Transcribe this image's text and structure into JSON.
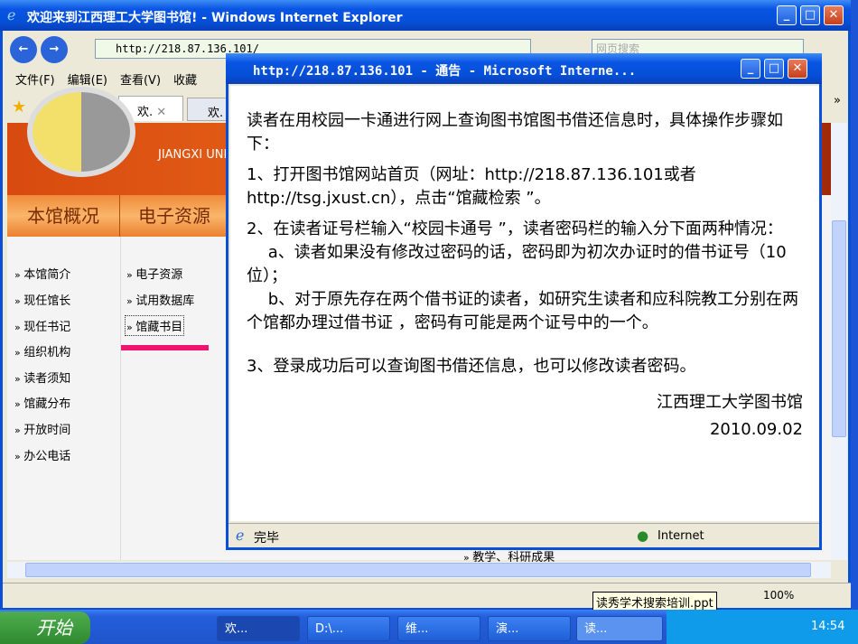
{
  "browser": {
    "title": "欢迎来到江西理工大学图书馆! - Windows Internet Explorer",
    "address": "http://218.87.136.101/",
    "search_placeholder": "网页搜索",
    "menu": [
      "文件(F)",
      "编辑(E)",
      "查看(V)",
      "收藏"
    ],
    "tabs": [
      "欢.",
      "欢."
    ],
    "banner_text": "JIANGXI UNI",
    "nav_tabs": [
      "本馆概况",
      "电子资源"
    ],
    "left_links": [
      "本馆简介",
      "现任馆长",
      "现任书记",
      "组织机构",
      "读者须知",
      "馆藏分布",
      "开放时间",
      "办公电话"
    ],
    "mid_links": [
      "电子资源",
      "试用数据库",
      "馆藏书目"
    ],
    "bottom_link": "教学、科研成果",
    "zoom": "100%",
    "chevron": "»"
  },
  "popup": {
    "title": "http://218.87.136.101 - 通告 - Microsoft Interne...",
    "paragraphs": [
      "读者在用校园一卡通进行网上查询图书馆图书借还信息时，具体操作步骤如下：",
      "1、打开图书馆网站首页（网址：http://218.87.136.101或者http://tsg.jxust.cn），点击“馆藏检索 ”。",
      "2、在读者证号栏输入“校园卡通号 ”，读者密码栏的输入分下面两种情况：",
      "　 a、读者如果没有修改过密码的话，密码即为初次办证时的借书证号（10位）；",
      "　 b、对于原先存在两个借书证的读者，如研究生读者和应科院教工分别在两个馆都办理过借书证 ，密码有可能是两个证号中的一个。",
      "3、登录成功后可以查询图书借还信息，也可以修改读者密码。"
    ],
    "signature": "江西理工大学图书馆",
    "date": "2010.09.02",
    "status": "完毕",
    "zone": "Internet"
  },
  "tooltip": "读秀学术搜索培训.ppt",
  "taskbar": {
    "start": "开始",
    "items": [
      "欢...",
      "D:\\...",
      "维...",
      "演...",
      "读..."
    ],
    "clock": "14:54"
  },
  "colors": {
    "xp_blue": "#0a54e3",
    "orange": "#e0661a",
    "highlight": "#f0146e"
  }
}
